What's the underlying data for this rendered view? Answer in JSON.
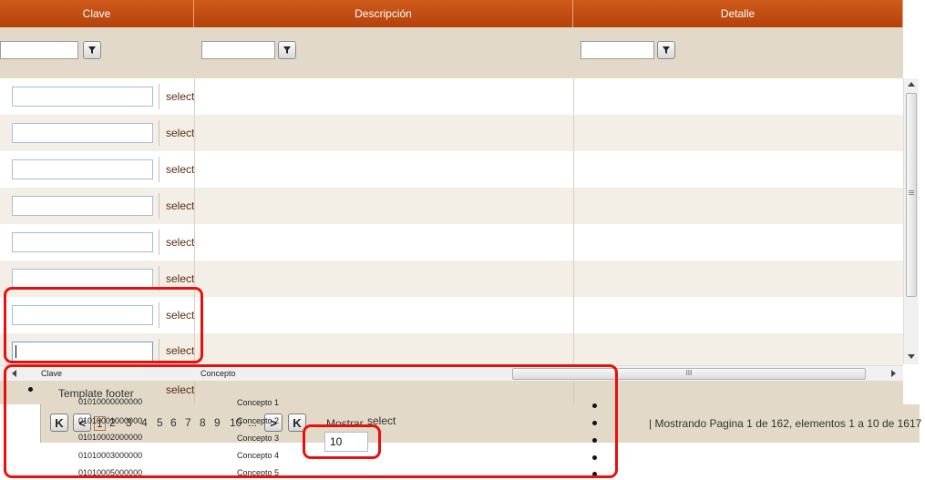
{
  "columns": [
    {
      "label": "Clave"
    },
    {
      "label": "Descripción"
    },
    {
      "label": "Detalle"
    }
  ],
  "row_action_label": "select",
  "row_count_visible": 8,
  "filter_icon": "filter-funnel-icon",
  "hscroll_grip": "III",
  "overlay": {
    "header_clave": "Clave",
    "header_concepto": "Concepto",
    "template_footer": "Template footer",
    "codes": [
      "01010000000000",
      "01010001000000",
      "01010002000000",
      "01010003000000",
      "01010005000000"
    ],
    "conceptos": [
      "Concepto 1",
      "Concepto 2",
      "Concepto 3",
      "Concepto 4",
      "Concepto 5"
    ]
  },
  "footer_select": "select",
  "pager": {
    "first_icon": "first-page-icon",
    "prev_icon": "prev-page-icon",
    "next_icon": "next-page-icon",
    "last_icon": "last-page-icon",
    "pages": [
      "1",
      "2",
      "3",
      "4",
      "5",
      "6",
      "7",
      "8",
      "9",
      "10",
      "..."
    ],
    "current_page": "1",
    "show_label": "Mostrar",
    "show_select": "select",
    "show_value": "10",
    "status": "| Mostrando Pagina 1 de 162, elementos 1 a 10 de 1617"
  }
}
